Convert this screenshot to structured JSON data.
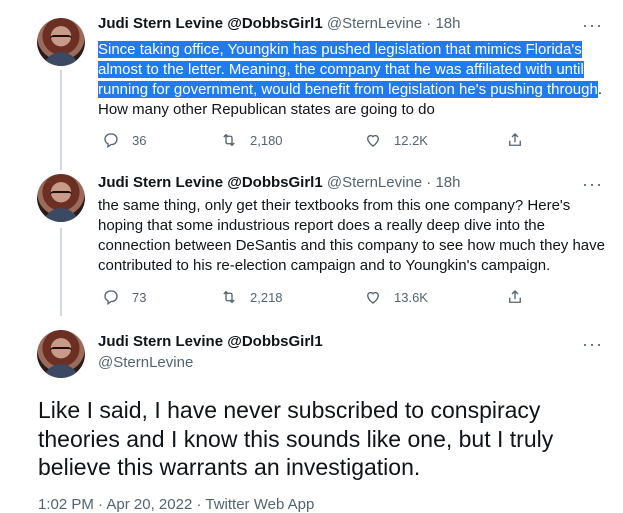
{
  "tweets": [
    {
      "name": "Judi Stern Levine @DobbsGirl1",
      "handle": "@SternLevine",
      "time": "18h",
      "text_highlight": "Since taking office, Youngkin has pushed legislation that mimics Florida's almost to the letter. Meaning, the company that he was affiliated with until running for government, would benefit from legislation he's pushing through",
      "text_rest": ". How many other Republican states are going to do",
      "replies": "36",
      "retweets": "2,180",
      "likes": "12.2K"
    },
    {
      "name": "Judi Stern Levine @DobbsGirl1",
      "handle": "@SternLevine",
      "time": "18h",
      "text": "the same thing, only get their textbooks from this one company? Here's hoping that some industrious report does a really deep dive into the connection between DeSantis and this company to see how much they have contributed to his re-election campaign and to Youngkin's campaign.",
      "replies": "73",
      "retweets": "2,218",
      "likes": "13.6K"
    }
  ],
  "main_tweet": {
    "name": "Judi Stern Levine @DobbsGirl1",
    "handle": "@SternLevine",
    "text": "Like I said, I have never subscribed to conspiracy theories and I know this sounds like one, but I truly believe this warrants an investigation.",
    "time": "1:02 PM",
    "date": "Apr 20, 2022",
    "source": "Twitter Web App"
  },
  "colors": {
    "highlight": "#1e7bf0",
    "secondary_text": "#536471",
    "thread_line": "#cfd9de"
  },
  "icons": [
    "reply-icon",
    "retweet-icon",
    "like-icon",
    "share-icon",
    "more-icon"
  ]
}
